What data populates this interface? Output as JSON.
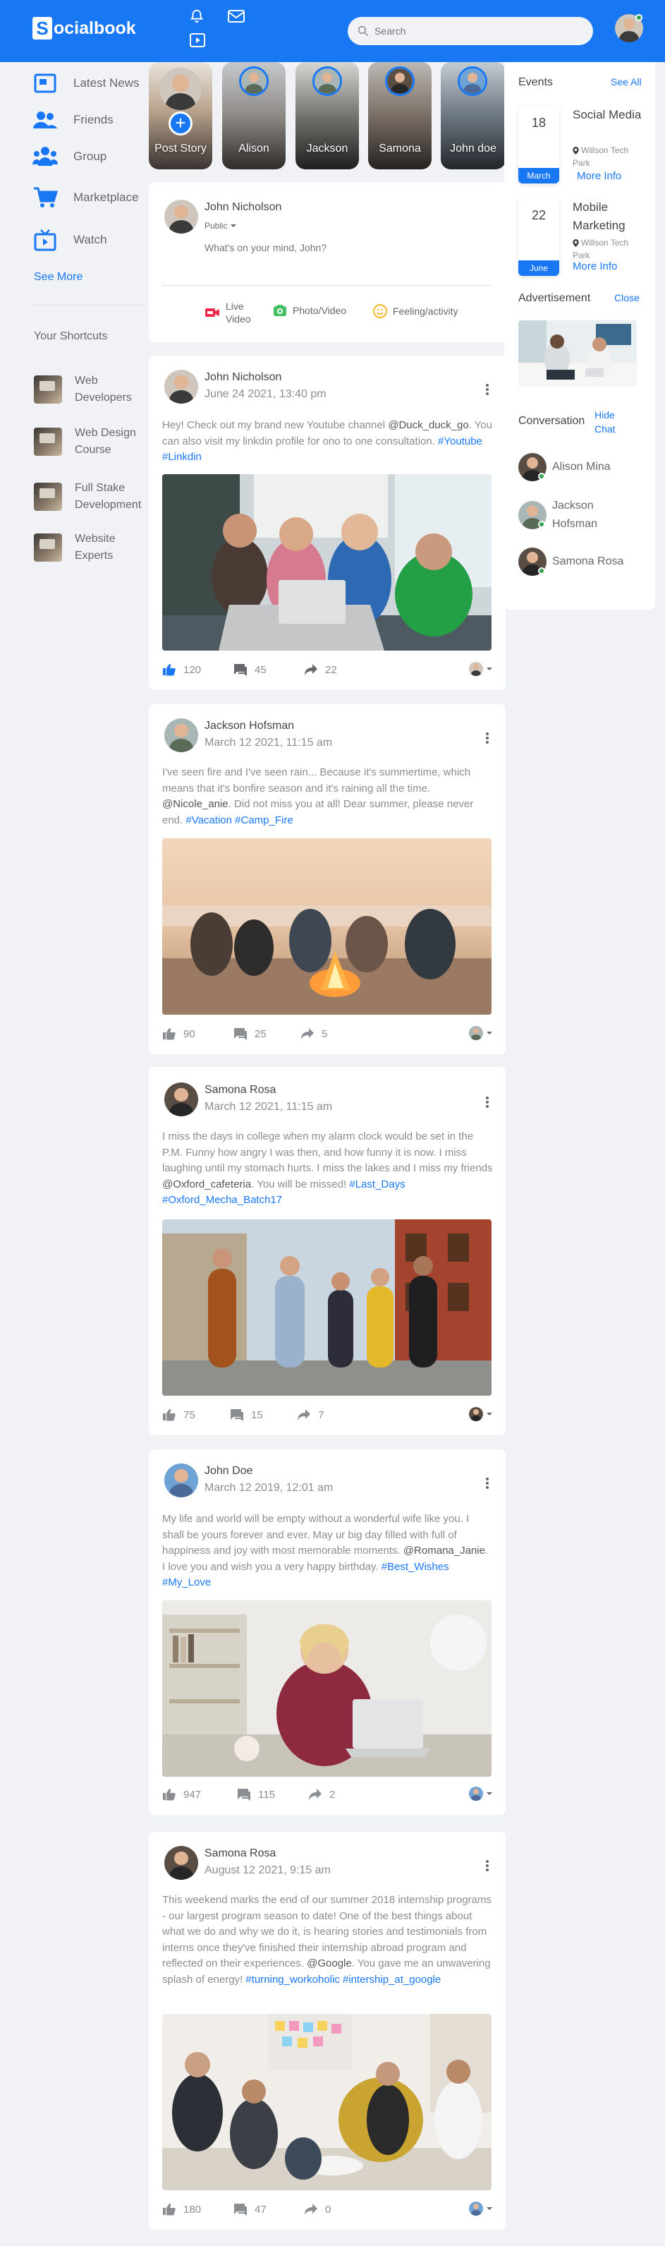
{
  "header": {
    "logo_letter": "S",
    "logo_rest": "ocialbook",
    "search_placeholder": "Search"
  },
  "sidebar": {
    "items": [
      {
        "label": "Latest News",
        "icon": "newspaper-icon"
      },
      {
        "label": "Friends",
        "icon": "friends-icon"
      },
      {
        "label": "Group",
        "icon": "group-icon"
      },
      {
        "label": "Marketplace",
        "icon": "cart-icon"
      },
      {
        "label": "Watch",
        "icon": "tv-icon"
      }
    ],
    "see_more": "See More",
    "shortcuts_title": "Your Shortcuts",
    "shortcuts": [
      {
        "line1": "Web",
        "line2": "Developers"
      },
      {
        "line1": "Web Design",
        "line2": "Course"
      },
      {
        "line1": "Full Stake",
        "line2": "Development"
      },
      {
        "line1": "Website",
        "line2": "Experts"
      }
    ]
  },
  "stories": [
    {
      "name": "Post Story"
    },
    {
      "name": "Alison"
    },
    {
      "name": "Jackson"
    },
    {
      "name": "Samona"
    },
    {
      "name": "John doe"
    }
  ],
  "composer": {
    "name": "John Nicholson",
    "privacy": "Public",
    "placeholder": "What's on your mind, John?",
    "actions": {
      "live_line1": "Live",
      "live_line2": "Video",
      "photo": "Photo/Video",
      "feeling": "Feeling/activity"
    }
  },
  "posts": [
    {
      "author": "John Nicholson",
      "date": "June 24 2021, 13:40 pm",
      "text_a": "Hey! Check out my brand new Youtube channel",
      "mention": "@Duck_duck_go",
      "text_b": ". You can also visit my linkdin profile for ono to one consultation.",
      "tags": "#Youtube #Linkdin",
      "likes": "120",
      "comments": "45",
      "shares": "22"
    },
    {
      "author": "Jackson Hofsman",
      "date": "March 12 2021, 11:15 am",
      "text_a": "I've seen fire and I've seen rain... Because it's summertime, which means that it's bonfire season and it's raining all the time.",
      "mention": "@Nicole_anie",
      "text_b": ". Did not miss you at all! Dear summer, please never end.",
      "tags": "#Vacation #Camp_Fire",
      "likes": "90",
      "comments": "25",
      "shares": "5"
    },
    {
      "author": "Samona Rosa",
      "date": "March 12 2021, 11:15 am",
      "text_a": "I miss the days in college when my alarm clock would be set in the P.M. Funny how angry I was then, and how funny it is now. I miss laughing until my stomach hurts. I miss the lakes and I miss my friends",
      "mention": "@Oxford_cafeteria",
      "text_b": ". You will be missed!",
      "tags": "#Last_Days #Oxford_Mecha_Batch17",
      "likes": "75",
      "comments": "15",
      "shares": "7"
    },
    {
      "author": "John Doe",
      "date": "March 12 2019, 12:01 am",
      "text_a": "My life and world will be empty without a wonderful wife like you. I shall be yours forever and ever. May ur big day filled with full of happiness and joy with most memorable moments.",
      "mention": "@Romana_Janie",
      "text_b": ". I love you and wish you a very happy birthday.",
      "tags": "#Best_Wishes #My_Love",
      "likes": "947",
      "comments": "115",
      "shares": "2"
    },
    {
      "author": "Samona Rosa",
      "date": "August 12 2021, 9:15 am",
      "text_a": "This weekend marks the end of our summer 2018 internship programs - our largest program season to date! One of the best things about what we do and why we do it, is hearing stories and testimonials from interns once they've finished their internship abroad program and reflected on their experiences.",
      "mention": "@Google",
      "text_b": ". You gave me an unwavering splash of energy!",
      "tags": "#turning_workoholic #intership_at_google",
      "likes": "180",
      "comments": "47",
      "shares": "0"
    }
  ],
  "right": {
    "events_title": "Events",
    "see_all": "See All",
    "events": [
      {
        "day": "18",
        "month": "March",
        "title": "Social Media",
        "loc1": "Willson Tech",
        "loc2": "Park",
        "more": "More Info"
      },
      {
        "day": "22",
        "month": "June",
        "title": "Mobile Marketing",
        "loc1": "Willson Tech",
        "loc2": "Park",
        "more": "More Info"
      }
    ],
    "ad_title": "Advertisement",
    "close": "Close",
    "conv_title": "Conversation",
    "hide_chat_1": "Hide",
    "hide_chat_2": "Chat",
    "contacts": [
      {
        "line1": "Alison Mina",
        "line2": ""
      },
      {
        "line1": "Jackson",
        "line2": "Hofsman"
      },
      {
        "line1": "Samona Rosa",
        "line2": ""
      }
    ]
  },
  "colors": {
    "brand": "#1877f2",
    "online": "#31a24c",
    "live": "#f02849",
    "photo": "#45bd62",
    "feeling": "#f7b928"
  }
}
